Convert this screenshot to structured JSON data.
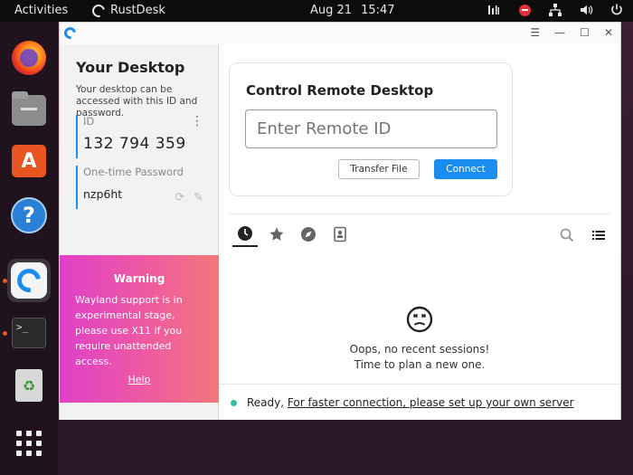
{
  "topbar": {
    "activities": "Activities",
    "app_name": "RustDesk",
    "date": "Aug 21",
    "time": "15:47"
  },
  "dock": {
    "items": [
      {
        "name": "Firefox",
        "icon": "firefox-icon"
      },
      {
        "name": "Files",
        "icon": "files-icon"
      },
      {
        "name": "Ubuntu Software",
        "icon": "software-store-icon"
      },
      {
        "name": "Help",
        "icon": "help-icon"
      },
      {
        "name": "RustDesk",
        "icon": "rustdesk-icon",
        "active": true
      },
      {
        "name": "Terminal",
        "icon": "terminal-icon"
      },
      {
        "name": "Trash",
        "icon": "trash-icon"
      },
      {
        "name": "Show Applications",
        "icon": "app-grid-icon"
      }
    ],
    "terminal_glyph": ">_",
    "help_glyph": "?",
    "store_glyph": "A",
    "trash_glyph": "♻"
  },
  "sidebar": {
    "title": "Your Desktop",
    "description": "Your desktop can be accessed with this ID and password.",
    "id_label": "ID",
    "id_value": "132 794 359",
    "password_label": "One-time Password",
    "password_value": "nzp6ht"
  },
  "warning": {
    "title": "Warning",
    "text": "Wayland support is in experimental stage, please use X11 if you require unattended access.",
    "help": "Help"
  },
  "control": {
    "title": "Control Remote Desktop",
    "input_placeholder": "Enter Remote ID",
    "transfer_label": "Transfer File",
    "connect_label": "Connect"
  },
  "sessions": {
    "empty_line1": "Oops, no recent sessions!",
    "empty_line2": "Time to plan a new one."
  },
  "status": {
    "ready": "Ready, ",
    "link": "For faster connection, please set up your own server"
  },
  "colors": {
    "accent": "#1a8ef0",
    "status_ok": "#32bea6",
    "warning_from": "#e040c8",
    "warning_to": "#f2787a"
  }
}
